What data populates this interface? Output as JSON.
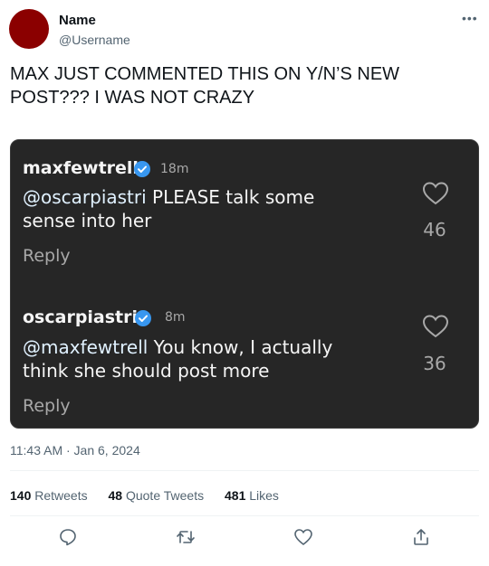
{
  "author": {
    "name": "Name",
    "handle": "@Username"
  },
  "more_label": "•••",
  "tweet_text": "MAX JUST COMMENTED THIS ON Y/N’S NEW POST??? I WAS NOT CRAZY",
  "screenshot": {
    "comments": [
      {
        "user": "maxfewtrell",
        "time": "18m",
        "mention": "@oscarpiastri",
        "text": " PLEASE talk some sense into her",
        "reply": "Reply",
        "likes": "46"
      },
      {
        "user": "oscarpiastri",
        "time": "8m",
        "mention": "@maxfewtrell",
        "text": " You know, I actually think she should post more",
        "reply": "Reply",
        "likes": "36"
      }
    ]
  },
  "timestamp": "11:43 AM · Jan 6, 2024",
  "stats": {
    "retweets_count": "140",
    "retweets_label": "Retweets",
    "quotes_count": "48",
    "quotes_label": "Quote Tweets",
    "likes_count": "481",
    "likes_label": "Likes"
  },
  "actions": [
    "reply-icon",
    "retweet-icon",
    "like-icon",
    "share-icon"
  ],
  "colors": {
    "avatar": "#8b0000",
    "card": "#262626",
    "verified": "#3897f0"
  }
}
